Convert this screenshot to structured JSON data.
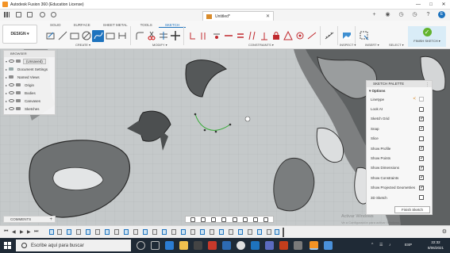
{
  "window": {
    "title": "Autodesk Fusion 360 (Education License)",
    "controls": [
      "—",
      "□",
      "✕"
    ]
  },
  "document_tab": {
    "title": "Untitled*",
    "close": "✕"
  },
  "ribbon": {
    "design_button": "DESIGN ▾",
    "tabs": [
      "SOLID",
      "SURFACE",
      "SHEET METAL",
      "TOOLS",
      "SKETCH"
    ],
    "active_tab": "SKETCH",
    "groups": {
      "create": "CREATE ▾",
      "modify": "MODIFY ▾",
      "constraints": "CONSTRAINTS ▾",
      "inspect": "INSPECT ▾",
      "insert": "INSERT ▾",
      "select": "SELECT ▾",
      "finish_sketch": "FINISH SKETCH ▾"
    }
  },
  "browser": {
    "header": "BROWSER",
    "root": "(Unsaved)",
    "items": [
      "Document Settings",
      "Named Views",
      "Origin",
      "Bodies",
      "Canvases",
      "Sketches"
    ]
  },
  "comments": {
    "label": "COMMENTS",
    "add": "+"
  },
  "sketch_palette": {
    "header": "SKETCH PALETTE",
    "section": "Options",
    "rows": [
      {
        "label": "Linetype",
        "checked": null
      },
      {
        "label": "Look At",
        "checked": null
      },
      {
        "label": "Sketch Grid",
        "checked": true
      },
      {
        "label": "Snap",
        "checked": true
      },
      {
        "label": "Slice",
        "checked": false
      },
      {
        "label": "Show Profile",
        "checked": true
      },
      {
        "label": "Show Points",
        "checked": true
      },
      {
        "label": "Show Dimensions",
        "checked": true
      },
      {
        "label": "Show Constraints",
        "checked": true
      },
      {
        "label": "Show Projected Geometries",
        "checked": true
      },
      {
        "label": "3D Sketch",
        "checked": false
      }
    ],
    "finish_button": "Finish Sketch"
  },
  "watermark": {
    "line1": "Activar Windows",
    "line2": "Ve a Configuración para activar Windows."
  },
  "taskbar": {
    "search_placeholder": "Escribe aquí para buscar",
    "language": "ESP",
    "time": "22:32",
    "date": "8/06/2021"
  },
  "colors": {
    "accent": "#1e73be",
    "finish_green": "#63b32e",
    "taskbar": "#1f2a36"
  }
}
